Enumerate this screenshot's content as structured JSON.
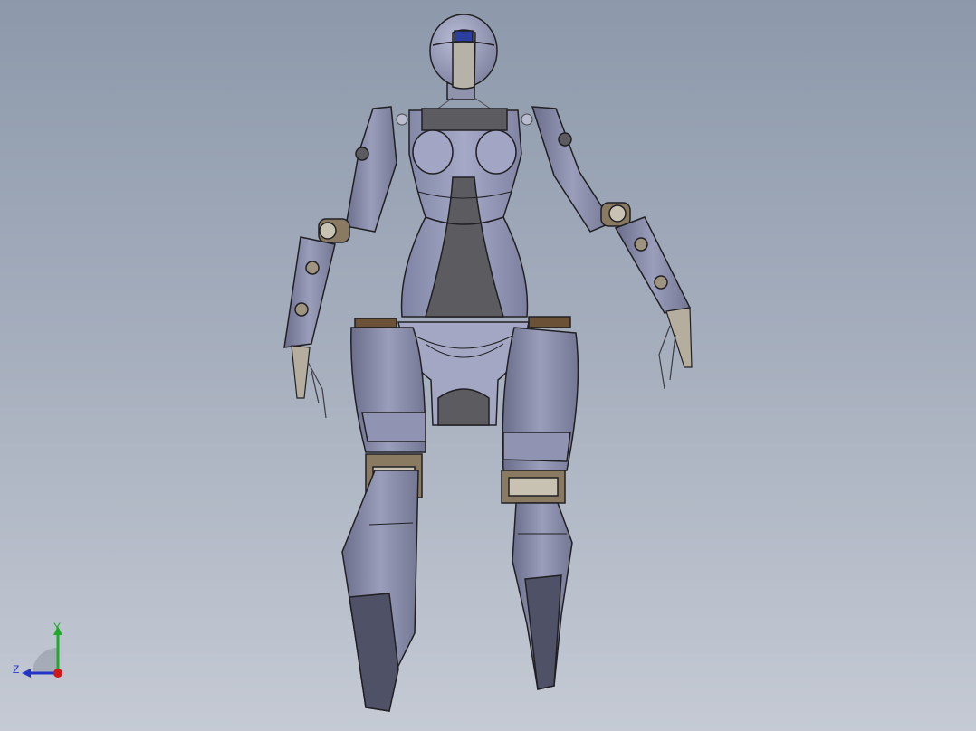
{
  "viewport": {
    "background_top": "#8d99ab",
    "background_bottom": "#c5cad4"
  },
  "model": {
    "body_color": "#9ea2c0",
    "panel_dark": "#5c5c60",
    "edge_color": "#202024",
    "joint_color": "#8a7a62",
    "visor_color": "#2c3e9e"
  },
  "triad": {
    "y_label": "Y",
    "z_label": "Z",
    "y_color": "#1faa2a",
    "z_color": "#2434c8",
    "x_color": "#d01818"
  }
}
